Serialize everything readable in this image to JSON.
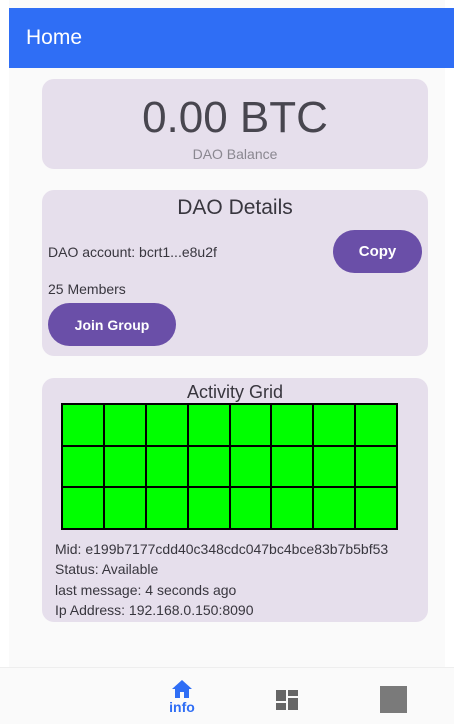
{
  "appbar": {
    "title": "Home"
  },
  "balance": {
    "amount": "0.00 BTC",
    "label": "DAO Balance"
  },
  "details": {
    "title": "DAO Details",
    "account": "DAO account: bcrt1...e8u2f",
    "copy_label": "Copy",
    "members": "25 Members",
    "join_label": "Join Group"
  },
  "activity": {
    "title": "Activity Grid",
    "rows": 3,
    "cols": 8,
    "cell_color": "#00ff00",
    "mid": "Mid: e199b7177cdd40c348cdc047bc4bce83b7b5bf53",
    "status": "Status: Available",
    "last_message": "last message: 4 seconds ago",
    "ip": "Ip Address: 192.168.0.150:8090"
  },
  "nav": {
    "items": [
      {
        "label": "info",
        "icon": "home-icon",
        "active": true
      },
      {
        "label": "",
        "icon": "dashboard-icon",
        "active": false
      },
      {
        "label": "",
        "icon": "square-icon",
        "active": false
      }
    ]
  },
  "colors": {
    "appbar": "#2f6ef5",
    "card": "#e6dfec",
    "button": "#6a4fa8",
    "active_nav": "#2f6ef5"
  }
}
